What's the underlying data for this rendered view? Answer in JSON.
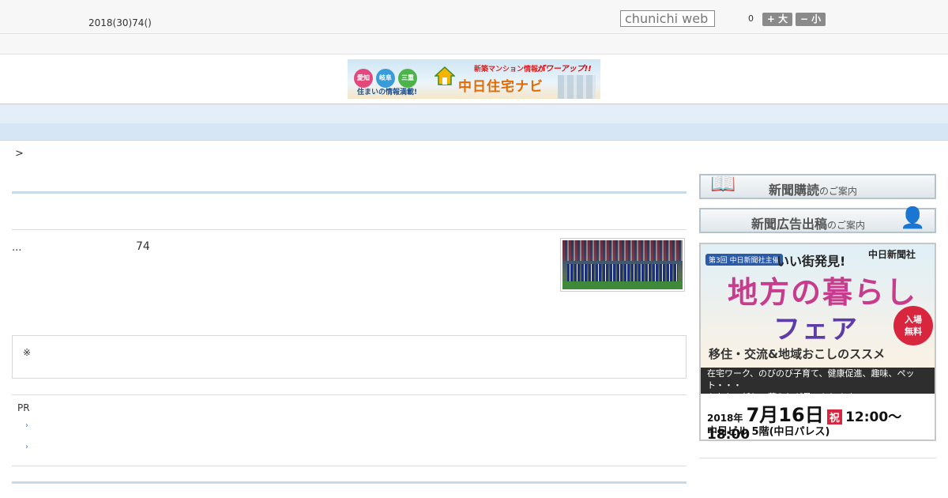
{
  "header": {
    "date_text": "2018(30)74()",
    "search_placeholder": "chunichi web",
    "font_size_value": "0",
    "font_larger_label": "+ 大",
    "font_smaller_label": "− 小"
  },
  "banner": {
    "badges": [
      "愛知",
      "岐阜",
      "三重"
    ],
    "tagline": "住まいの情報満載!",
    "title": "中日住宅ナビ",
    "subtitle": "新築マンション情報が",
    "power": "パワーアップ!!"
  },
  "nav": {
    "items": [
      "",
      "",
      "",
      "",
      "",
      "",
      "",
      "",
      ""
    ]
  },
  "breadcrumb": ">",
  "article": {
    "lead": "...",
    "count": "74"
  },
  "notice": {
    "mark": "※"
  },
  "pr": {
    "label": "PR",
    "links": [
      "›",
      "›"
    ]
  },
  "sidebar": {
    "subscribe_main": "新聞購読",
    "subscribe_suffix": "のご案内",
    "ads_main": "新聞広告出稿",
    "ads_suffix": "のご案内",
    "fair": {
      "kicker": "第3回 中日新聞社主催",
      "catch": "いい街発見!",
      "brand": "中日新聞社",
      "title_line1": "地方の暮らし",
      "title_line2": "フェア",
      "free_line1": "入場",
      "free_line2": "無料",
      "subtitle": "移住・交流&地域おこしのススメ",
      "desc_line1": "在宅ワーク、のびのび子育て、健康促進、趣味、ペット・・・",
      "desc_line2": "あなたの新しい暮らしが見つかります",
      "year": "2018年",
      "date": "7月16日",
      "holiday": "祝",
      "time": "12:00〜18:00",
      "venue": "中日ビル 5階(中日パレス)"
    }
  }
}
